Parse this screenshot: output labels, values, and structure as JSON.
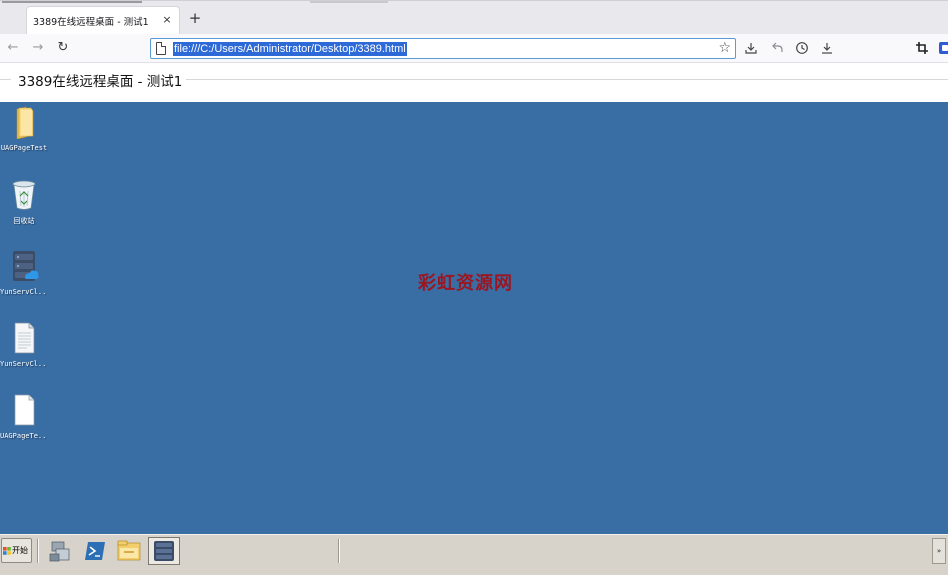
{
  "browser": {
    "tab_title": "3389在线远程桌面 - 测试1",
    "tab_close": "×",
    "new_tab": "+",
    "url": "file:///C:/Users/Administrator/Desktop/3389.html",
    "nav": {
      "back": "←",
      "forward": "→",
      "reload": "↻"
    }
  },
  "page": {
    "title": "3389在线远程桌面 - 测试1"
  },
  "desktop": {
    "background_color": "#396ea5",
    "watermark": "彩虹资源网",
    "icons": [
      {
        "label": "UAGPageTest",
        "icon": "folder-icon"
      },
      {
        "label": "回收站",
        "icon": "recycle-bin-icon"
      },
      {
        "label": "YunServCl...",
        "icon": "server-cloud-icon"
      },
      {
        "label": "YunServCl...",
        "icon": "document-icon"
      },
      {
        "label": "UAGPageTe...",
        "icon": "blank-file-icon"
      }
    ]
  },
  "taskbar": {
    "start_label": "开始",
    "tray_toggle": "»"
  }
}
